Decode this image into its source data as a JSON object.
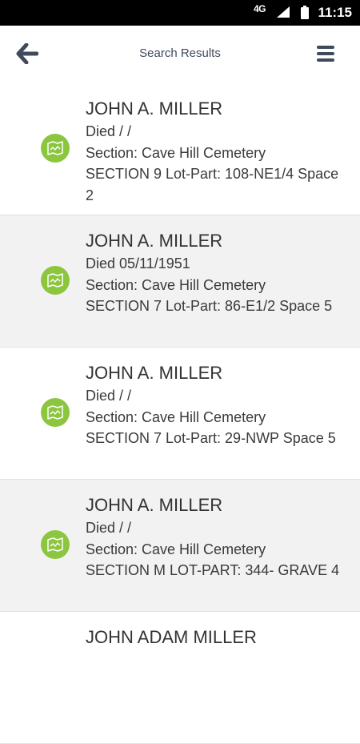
{
  "status_bar": {
    "network": "4G",
    "time": "11:15"
  },
  "header": {
    "title": "Search Results"
  },
  "results": [
    {
      "name": "JOHN A. MILLER",
      "died": "Died /  /",
      "section": "Section: Cave Hill Cemetery",
      "location": "SECTION 9 Lot-Part: 108-NE1/4 Space 2"
    },
    {
      "name": "JOHN A. MILLER",
      "died": "Died 05/11/1951",
      "section": "Section: Cave Hill Cemetery",
      "location": "SECTION 7 Lot-Part: 86-E1/2  Space 5"
    },
    {
      "name": "JOHN A. MILLER",
      "died": "Died /  /",
      "section": "Section: Cave Hill Cemetery",
      "location": "SECTION 7 Lot-Part: 29-NWP  Space 5"
    },
    {
      "name": "JOHN A. MILLER",
      "died": "Died /  /",
      "section": "Section: Cave Hill Cemetery",
      "location": "SECTION M LOT-PART: 344-  GRAVE 4"
    },
    {
      "name": "JOHN ADAM MILLER"
    }
  ],
  "colors": {
    "accent": "#8cc63f",
    "header_text": "#3f4a5a",
    "alt_row": "#f2f2f2"
  }
}
